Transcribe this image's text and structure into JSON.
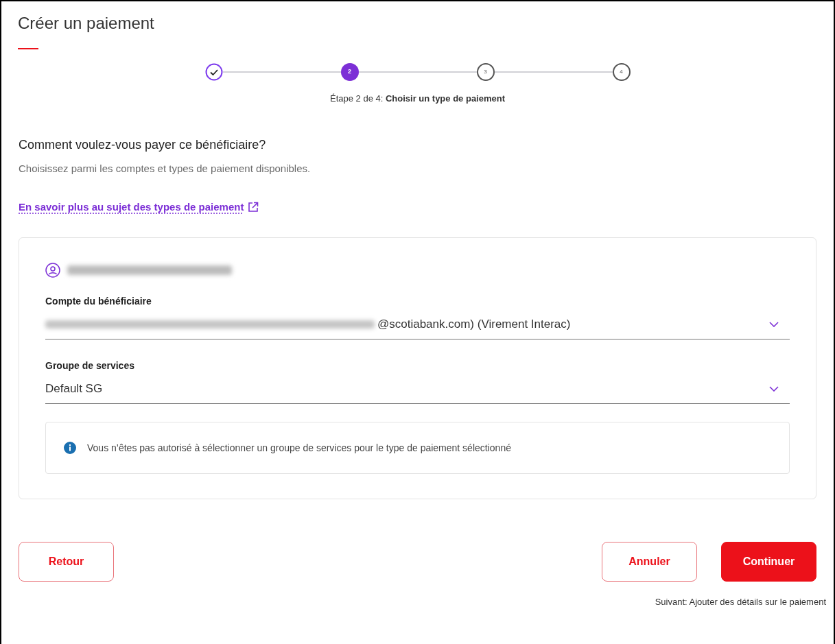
{
  "title": "Créer un paiement",
  "stepper": {
    "steps": [
      {
        "kind": "done"
      },
      {
        "kind": "current",
        "label": "2"
      },
      {
        "kind": "pending",
        "label": "3"
      },
      {
        "kind": "pending",
        "label": "4"
      }
    ],
    "caption": "Étape 2 de 4: **Choisir un type de paiement**"
  },
  "heading": "Comment voulez-vous payer ce bénéficiaire?",
  "subheading": "Choisissez parmi les comptes et types de paiement disponibles.",
  "link": "En savoir plus au sujet des types de paiement",
  "card": {
    "payee_name_redacted": true,
    "fields": [
      {
        "label": "Compte du bénéficiaire",
        "value_redacted": true,
        "value": "@scotiabank.com) (Virement Interac)"
      },
      {
        "label": "Groupe de services",
        "value_redacted": false,
        "value": "Default SG"
      }
    ],
    "notice": "Vous n’êtes pas autorisé à sélectionner un groupe de services pour le type de paiement sélectionné"
  },
  "buttons": [
    {
      "label": "Retour",
      "kind": "outline"
    },
    {
      "label": "Annuler",
      "kind": "outline"
    },
    {
      "label": "Continuer",
      "kind": "primary"
    }
  ],
  "next_hint": "Suivant: Ajouter des détails sur le paiement"
}
